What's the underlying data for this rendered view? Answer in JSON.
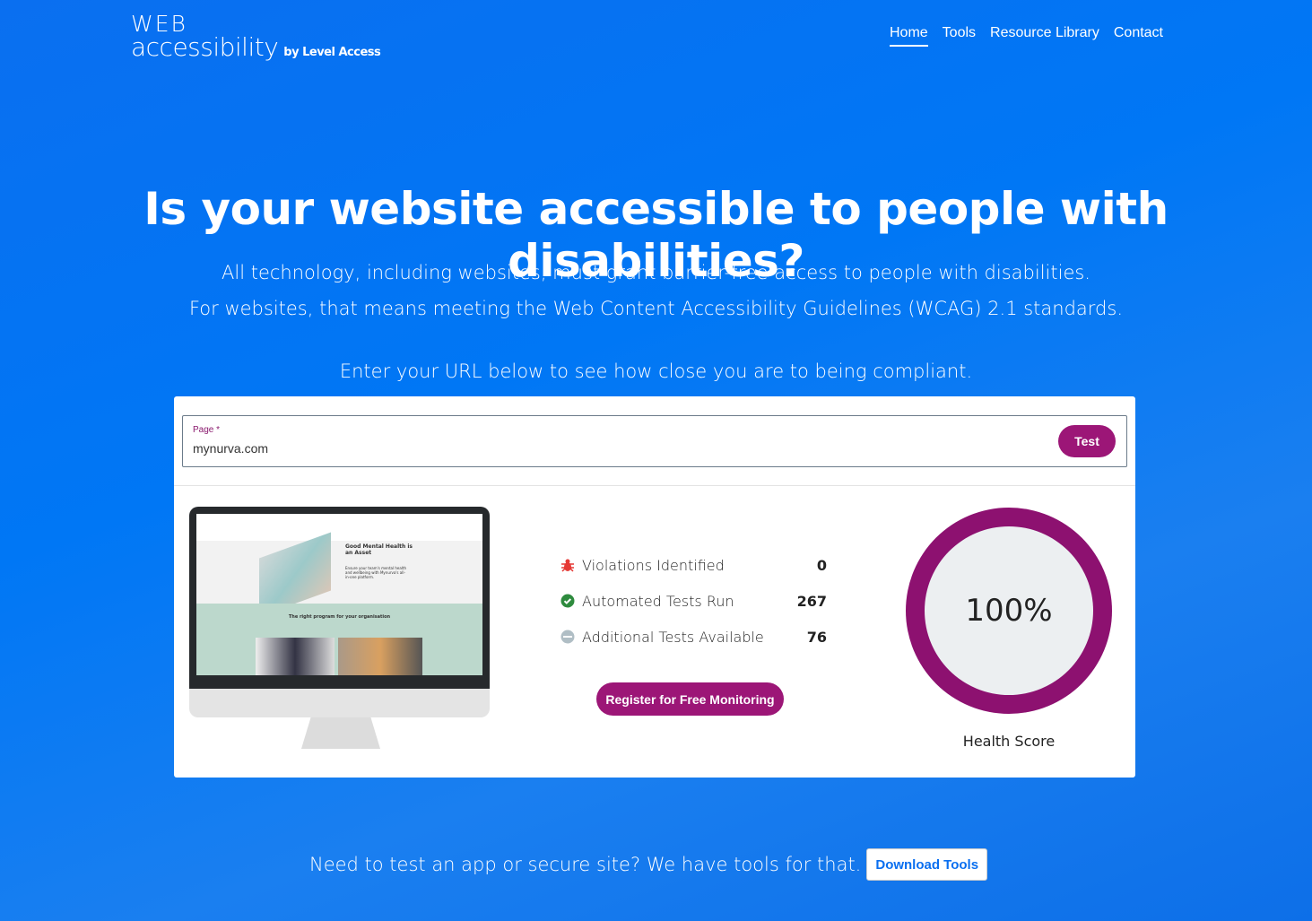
{
  "logo": {
    "line1": "WEB",
    "line2": "accessibility",
    "by": "by Level Access"
  },
  "nav": [
    {
      "label": "Home",
      "active": true
    },
    {
      "label": "Tools"
    },
    {
      "label": "Resource Library"
    },
    {
      "label": "Contact"
    }
  ],
  "hero": {
    "title": "Is your website accessible to people with disabilities?",
    "line1": "All technology, including websites, must grant barrier-free access to people with disabilities.",
    "line2": "For websites, that means meeting the Web Content Accessibility Guidelines (WCAG) 2.1 standards.",
    "prompt": "Enter your URL below to see how close you are to being compliant."
  },
  "form": {
    "label": "Page *",
    "value": "mynurva.com",
    "test_label": "Test"
  },
  "preview": {
    "heading": "Good Mental Health is an Asset",
    "text": "Ensure your team's mental health and wellbeing with Mynurva's all-in-one platform.",
    "section": "The right program for your organisation"
  },
  "stats": [
    {
      "icon": "bug-icon",
      "label": "Violations Identified",
      "value": "0",
      "color": "#e53935"
    },
    {
      "icon": "check-badge-icon",
      "label": "Automated Tests Run",
      "value": "267",
      "color": "#2e8b3e"
    },
    {
      "icon": "minus-circle-icon",
      "label": "Additional Tests Available",
      "value": "76",
      "color": "#b0bec5"
    }
  ],
  "register_label": "Register for Free Monitoring",
  "score": {
    "value": "100%",
    "label": "Health Score",
    "percent": 100,
    "color": "#8d1170"
  },
  "bottom": {
    "text": "Need to test an app or secure site? We have tools for that.",
    "button": "Download Tools"
  }
}
